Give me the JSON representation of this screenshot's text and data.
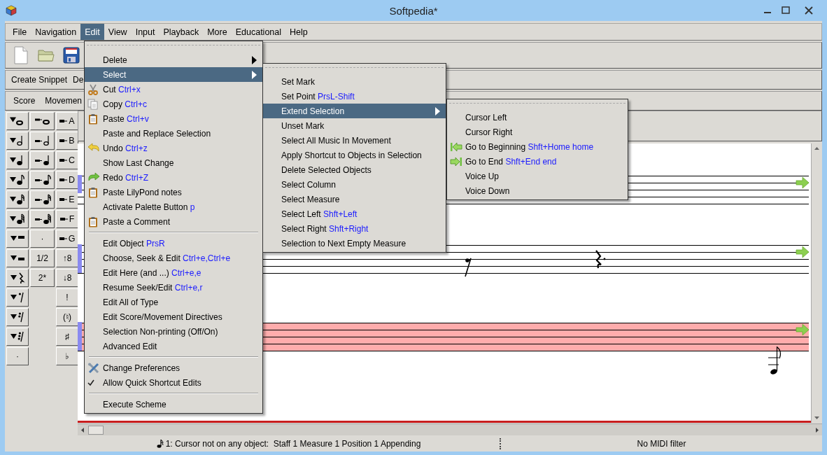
{
  "window": {
    "title": "Softpedia*"
  },
  "menubar": [
    {
      "label": "File",
      "selected": false
    },
    {
      "label": "Navigation",
      "selected": false
    },
    {
      "label": "Edit",
      "selected": true
    },
    {
      "label": "View",
      "selected": false
    },
    {
      "label": "Input",
      "selected": false
    },
    {
      "label": "Playback",
      "selected": false
    },
    {
      "label": "More",
      "selected": false
    },
    {
      "label": "Educational",
      "selected": false
    },
    {
      "label": "Help",
      "selected": false
    }
  ],
  "toolbar": [
    {
      "kind": "new"
    },
    {
      "kind": "open"
    },
    {
      "kind": "save"
    }
  ],
  "snippet_bar": [
    "Create Snippet",
    "De"
  ],
  "score_bar": [
    "Score",
    "Movemen"
  ],
  "palette": [
    [
      {
        "kind": "change-note"
      },
      {
        "kind": "insert-note"
      },
      {
        "kind": "insert-key",
        "label": "A"
      }
    ],
    [
      {
        "kind": "change-note"
      },
      {
        "kind": "insert-note"
      },
      {
        "kind": "insert-key",
        "label": "B"
      }
    ],
    [
      {
        "kind": "change-note"
      },
      {
        "kind": "insert-note"
      },
      {
        "kind": "insert-key",
        "label": "C"
      }
    ],
    [
      {
        "kind": "change-note"
      },
      {
        "kind": "insert-note"
      },
      {
        "kind": "insert-key",
        "label": "D"
      }
    ],
    [
      {
        "kind": "change-note"
      },
      {
        "kind": "insert-note"
      },
      {
        "kind": "insert-key",
        "label": "E"
      }
    ],
    [
      {
        "kind": "change-note"
      },
      {
        "kind": "insert-note"
      },
      {
        "kind": "insert-key",
        "label": "F"
      }
    ],
    [
      {
        "kind": "change-rest"
      },
      {
        "kind": "text",
        "label": "·"
      },
      {
        "kind": "insert-key",
        "label": "G"
      }
    ],
    [
      {
        "kind": "change-rest"
      },
      {
        "kind": "text",
        "label": "1/2"
      },
      {
        "kind": "text",
        "label": "↑8"
      }
    ],
    [
      {
        "kind": "change-rest"
      },
      {
        "kind": "text",
        "label": "2*"
      },
      {
        "kind": "text",
        "label": "↓8"
      }
    ],
    [
      {
        "kind": "change-rest"
      },
      {
        "kind": "empty"
      },
      {
        "kind": "text",
        "label": "!"
      }
    ],
    [
      {
        "kind": "change-rest"
      },
      {
        "kind": "empty"
      },
      {
        "kind": "text",
        "label": "(♮)"
      }
    ],
    [
      {
        "kind": "change-rest"
      },
      {
        "kind": "empty"
      },
      {
        "kind": "text",
        "label": "♯"
      }
    ],
    [
      {
        "kind": "text",
        "label": "·"
      },
      {
        "kind": "empty"
      },
      {
        "kind": "text",
        "label": "♭"
      }
    ]
  ],
  "score": {
    "staves": [
      {
        "selected": false
      },
      {
        "selected": false
      },
      {
        "selected": true
      }
    ]
  },
  "status_bar": {
    "cursor": "1: Cursor not on any object:  Staff 1 Measure 1 Position 1 Appending",
    "midi": "No MIDI filter"
  },
  "edit_menu": [
    {
      "label": "Delete",
      "submenu": true,
      "selected": false
    },
    {
      "label": "Select",
      "submenu": true,
      "selected": true
    },
    {
      "label": "Cut",
      "shortcut": "Ctrl+x",
      "selected": false
    },
    {
      "label": "Copy",
      "shortcut": "Ctrl+c",
      "selected": false
    },
    {
      "label": "Paste",
      "shortcut": "Ctrl+v",
      "selected": false
    },
    {
      "label": "Paste and Replace Selection",
      "selected": false
    },
    {
      "label": "Undo",
      "shortcut": "Ctrl+z",
      "selected": false
    },
    {
      "label": "Show Last Change",
      "selected": false
    },
    {
      "label": "Redo",
      "shortcut": "Ctrl+Z",
      "selected": false
    },
    {
      "label": "Paste LilyPond notes",
      "selected": false
    },
    {
      "label": "Activate Palette Button",
      "shortcut": "p",
      "selected": false
    },
    {
      "label": "Paste a Comment",
      "selected": false
    },
    {
      "kind": "separator"
    },
    {
      "label": "Edit Object",
      "shortcut": "PrsR",
      "selected": false
    },
    {
      "label": "Choose, Seek & Edit",
      "shortcut": "Ctrl+e,Ctrl+e",
      "selected": false
    },
    {
      "label": "Edit Here (and ...)",
      "shortcut": "Ctrl+e,e",
      "selected": false
    },
    {
      "label": "Resume Seek/Edit",
      "shortcut": "Ctrl+e,r",
      "selected": false
    },
    {
      "label": "Edit All of Type",
      "selected": false
    },
    {
      "label": "Edit Score/Movement Directives",
      "selected": false
    },
    {
      "label": "Selection Non-printing (Off/On)",
      "selected": false
    },
    {
      "label": "Advanced Edit",
      "selected": false
    },
    {
      "kind": "separator"
    },
    {
      "label": "Change Preferences",
      "selected": false
    },
    {
      "label": "Allow Quick Shortcut Edits",
      "checked": true,
      "selected": false
    },
    {
      "kind": "separator"
    },
    {
      "label": "Execute Scheme",
      "selected": false
    }
  ],
  "select_menu": [
    {
      "label": "Set Mark",
      "selected": false
    },
    {
      "label": "Set Point",
      "shortcut": "PrsL-Shift",
      "selected": false
    },
    {
      "label": "Extend Selection",
      "submenu": true,
      "selected": true
    },
    {
      "label": "Unset Mark",
      "selected": false
    },
    {
      "label": "Select All Music In Movement",
      "selected": false
    },
    {
      "label": "Apply Shortcut to Objects in Selection",
      "selected": false
    },
    {
      "label": "Delete Selected Objects",
      "selected": false
    },
    {
      "label": "Select Column",
      "selected": false
    },
    {
      "label": "Select Measure",
      "selected": false
    },
    {
      "label": "Select Left",
      "shortcut": "Shft+Left",
      "selected": false
    },
    {
      "label": "Select Right",
      "shortcut": "Shft+Right",
      "selected": false
    },
    {
      "label": "Selection to Next Empty Measure",
      "selected": false
    }
  ],
  "extend_menu": [
    {
      "label": "Cursor Left",
      "selected": false
    },
    {
      "label": "Cursor Right",
      "selected": false
    },
    {
      "label": "Go to Beginning",
      "shortcut": "Shft+Home home",
      "selected": false
    },
    {
      "label": "Go to End",
      "shortcut": "Shft+End end",
      "selected": false
    },
    {
      "label": "Voice Up",
      "selected": false
    },
    {
      "label": "Voice Down",
      "selected": false
    }
  ]
}
